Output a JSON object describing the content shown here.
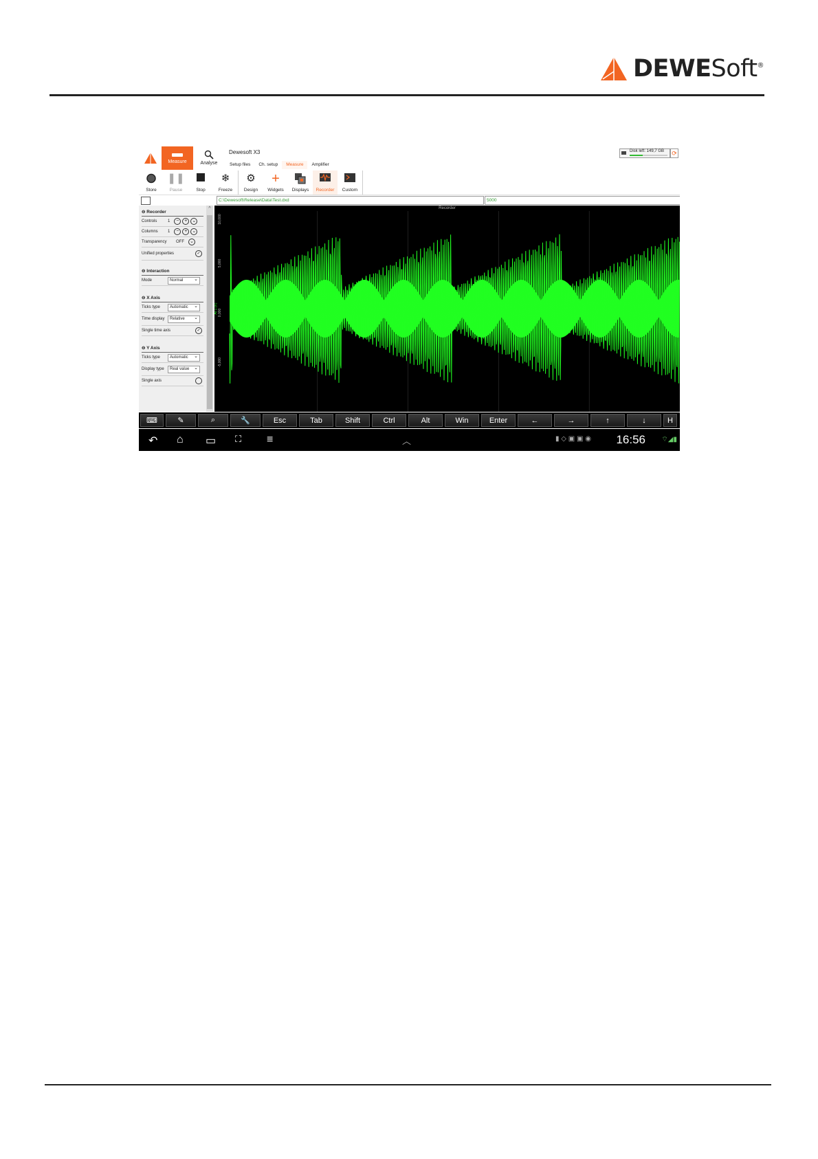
{
  "brand": {
    "name_bold": "DEWE",
    "name_light": "Soft",
    "reg": "®"
  },
  "app": {
    "tabs": {
      "measure": "Measure",
      "analyse": "Analyse"
    },
    "title": "Dewesoft X3",
    "subtabs": [
      "Setup files",
      "Ch. setup",
      "Measure",
      "Amplifier"
    ],
    "active_subtab": "Measure",
    "disk": {
      "label": "Disk left: 149,7 GB",
      "fill_fraction": 0.35
    },
    "toolbar": [
      "Store",
      "Pause",
      "Stop",
      "Freeze",
      "Design",
      "Widgets",
      "Displays",
      "Recorder",
      "Custom"
    ],
    "file_path": "C:\\Dewesoft\\Release\\Data\\Test.dxd",
    "value_field": "5000"
  },
  "panel": {
    "recorder": {
      "title": "Recorder",
      "controls_label": "Controls",
      "controls_value": "1",
      "columns_label": "Columns",
      "columns_value": "1",
      "transparency_label": "Transparency",
      "transparency_value": "OFF",
      "unified_label": "Unified properties"
    },
    "interaction": {
      "title": "Interaction",
      "mode_label": "Mode",
      "mode_value": "Normal"
    },
    "xaxis": {
      "title": "X Axis",
      "ticks_label": "Ticks type",
      "ticks_value": "Automatic",
      "time_label": "Time display",
      "time_value": "Relative",
      "single_label": "Single time axis"
    },
    "yaxis": {
      "title": "Y Axis",
      "ticks_label": "Ticks type",
      "ticks_value": "Automatic",
      "display_label": "Display type",
      "display_value": "Real value",
      "single_label": "Single axis"
    }
  },
  "graph": {
    "title": "Recorder",
    "y_ticks": [
      "10,000",
      "5,000",
      "0,000",
      "-5,000"
    ],
    "y_label": "AI 1 (V)",
    "trace_color": "#21ff21"
  },
  "keyboard": [
    "Esc",
    "Tab",
    "Shift",
    "Ctrl",
    "Alt",
    "Win",
    "Enter",
    "←",
    "→",
    "↑",
    "↓",
    "H"
  ],
  "status": {
    "clock": "16:56"
  },
  "colors": {
    "accent": "#f26522",
    "trace": "#21ff21"
  }
}
